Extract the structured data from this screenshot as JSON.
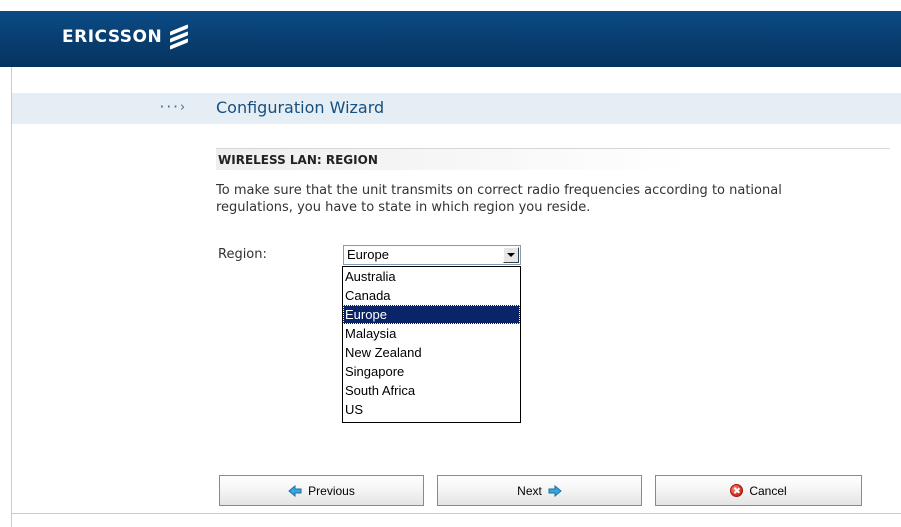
{
  "header": {
    "brand": "ERICSSON"
  },
  "wizard": {
    "nav_marker": "···›",
    "title": "Configuration Wizard"
  },
  "section": {
    "heading": "WIRELESS LAN: REGION",
    "description": "To make sure that the unit transmits on correct radio frequencies according to national regulations, you have to state in which region you reside."
  },
  "region": {
    "label": "Region:",
    "selected": "Europe",
    "options": [
      "Australia",
      "Canada",
      "Europe",
      "Malaysia",
      "New Zealand",
      "Singapore",
      "South Africa",
      "US"
    ]
  },
  "buttons": {
    "previous": "Previous",
    "next": "Next",
    "cancel": "Cancel"
  },
  "colors": {
    "header_bg": "#083d6f",
    "title_band": "#e5eef4",
    "title_text": "#174f7f",
    "arrow_icon": "#2f9fd8",
    "selection": "#0a246a"
  }
}
